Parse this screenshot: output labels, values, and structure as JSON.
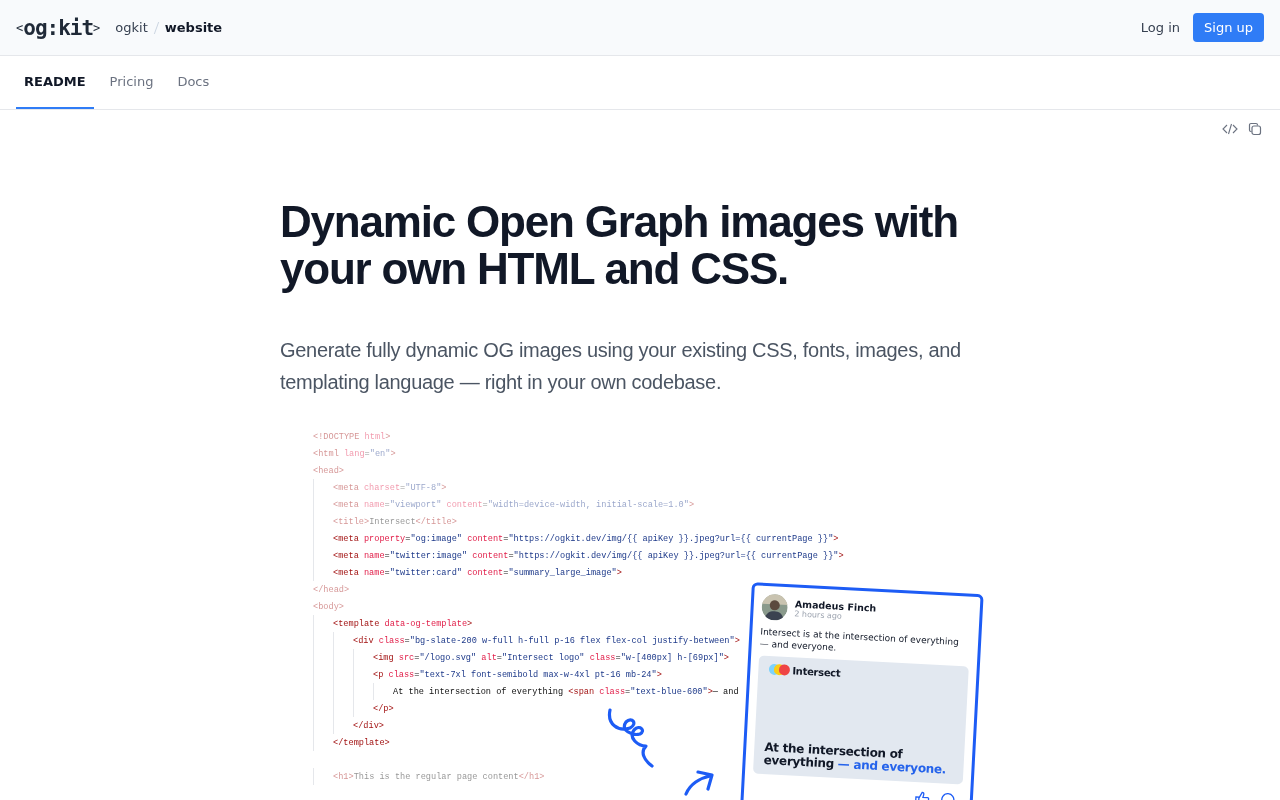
{
  "header": {
    "logo": {
      "open": "<",
      "name": "og:kit",
      "close": ">"
    },
    "breadcrumb": [
      {
        "label": "ogkit",
        "current": false
      },
      {
        "label": "website",
        "current": true
      }
    ],
    "login": "Log in",
    "signup": "Sign up"
  },
  "tabs": [
    {
      "label": "README",
      "selected": true
    },
    {
      "label": "Pricing",
      "selected": false
    },
    {
      "label": "Docs",
      "selected": false
    }
  ],
  "hero": {
    "title": "Dynamic Open Graph images with your own HTML and CSS.",
    "lead": "Generate fully dynamic OG images using your existing CSS, fonts, images, and templating language — right in your own codebase."
  },
  "code": [
    {
      "text": "<!DOCTYPE html>",
      "faded": true
    },
    {
      "text": "<html lang=\"en\">",
      "faded": true
    },
    {
      "text": "<head>",
      "faded": true,
      "children": [
        {
          "text": "<meta charset=\"UTF-8\">",
          "faded": true
        },
        {
          "text": "<meta name=\"viewport\" content=\"width=device-width, initial-scale=1.0\">",
          "faded": true
        },
        {
          "text": "<title>Intersect</title>",
          "faded": true
        },
        {
          "text": "<meta property=\"og:image\" content=\"https://ogkit.dev/img/{{ apiKey }}.jpeg?url={{ currentPage }}\">",
          "faded": false
        },
        {
          "text": "<meta name=\"twitter:image\" content=\"https://ogkit.dev/img/{{ apiKey }}.jpeg?url={{ currentPage }}\">",
          "faded": false
        },
        {
          "text": "<meta name=\"twitter:card\" content=\"summary_large_image\">",
          "faded": false
        }
      ]
    },
    {
      "text": "</head>",
      "faded": true
    },
    {
      "text": "<body>",
      "faded": true,
      "children": [
        {
          "text": "<template data-og-template>",
          "faded": false,
          "children": [
            {
              "text": "<div class=\"bg-slate-200 w-full h-full p-16 flex flex-col justify-between\">",
              "faded": false,
              "children": [
                {
                  "text": "<img src=\"/logo.svg\" alt=\"Intersect logo\" class=\"w-[400px] h-[69px]\">",
                  "faded": false
                },
                {
                  "text": "<p class=\"text-7xl font-semibold max-w-4xl pt-16 mb-24\">",
                  "faded": false,
                  "children": [
                    {
                      "text": "At the intersection of everything <span class=\"text-blue-600\">— and",
                      "faded": false
                    }
                  ]
                },
                {
                  "text": "</p>",
                  "faded": false
                }
              ]
            },
            {
              "text": "</div>",
              "faded": false
            }
          ]
        },
        {
          "text": "</template>",
          "faded": false
        },
        {
          "text": "<h1>This is the regular page content</h1>",
          "faded": true,
          "gap": true
        }
      ]
    }
  ],
  "post": {
    "author": "Amadeus Finch",
    "time": "2 hours ago",
    "body": "Intersect is at the intersection of everything — and everyone.",
    "brand": "Intersect",
    "headline": "At the intersection of everything",
    "headline_accent": "— and everyone."
  }
}
